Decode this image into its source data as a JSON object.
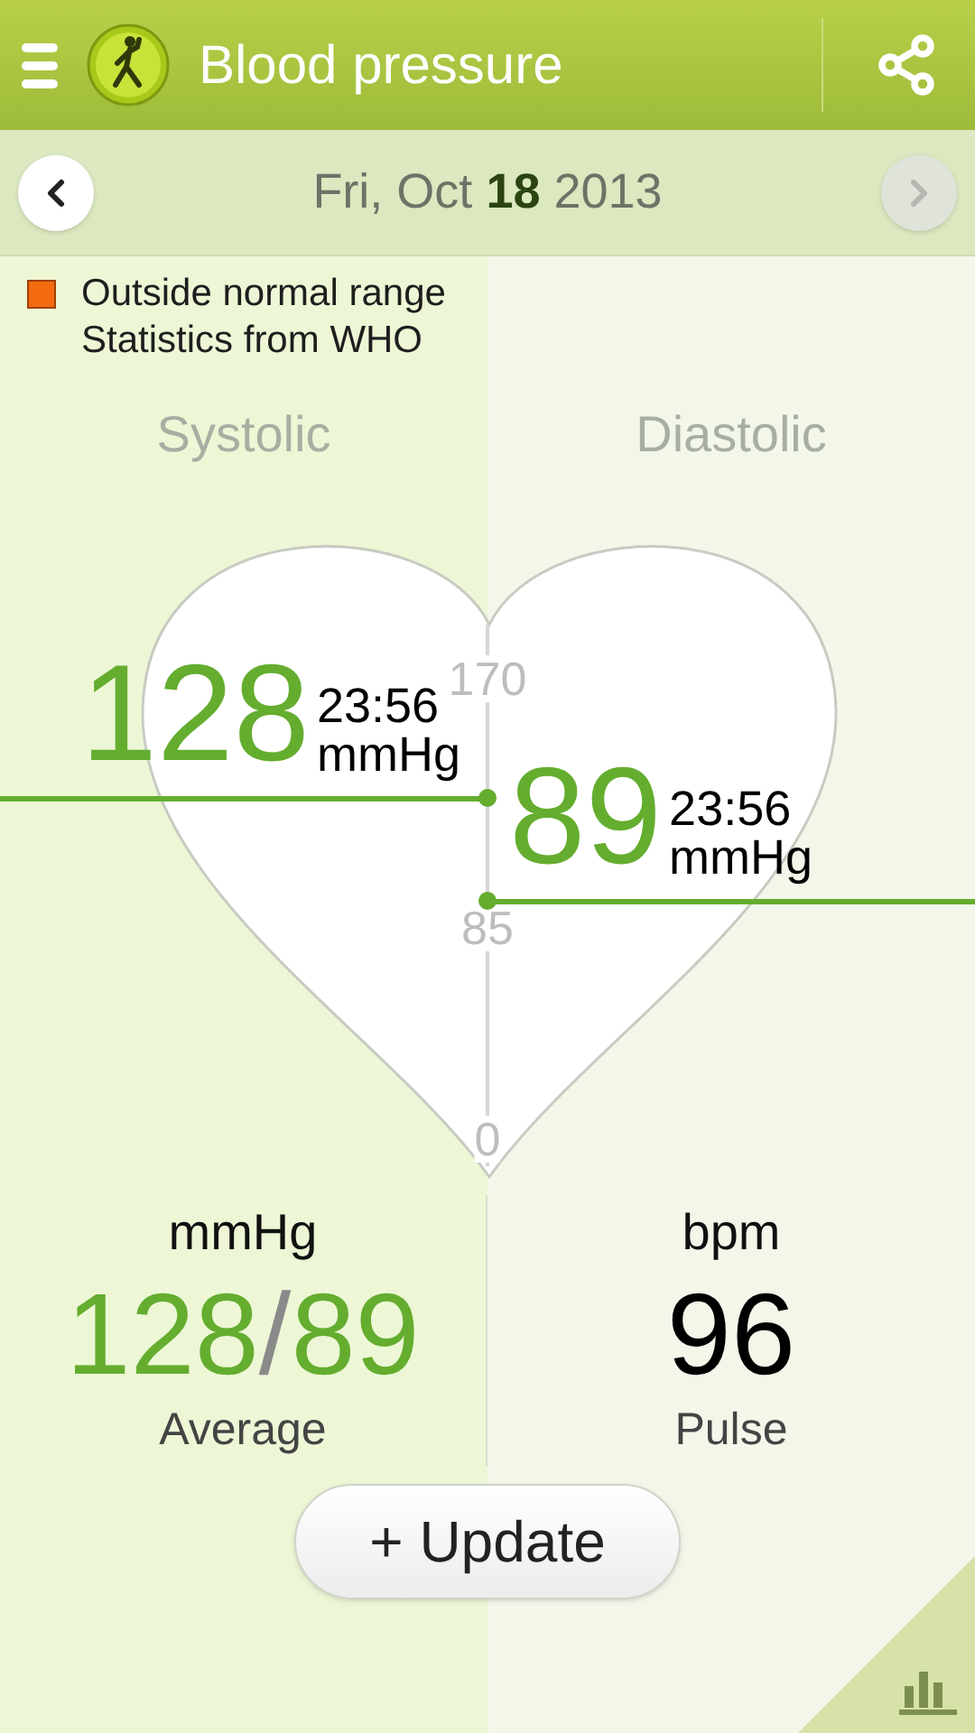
{
  "header": {
    "title": "Blood pressure"
  },
  "date_bar": {
    "date": "Fri, Oct **18** 2013",
    "prev": {
      "disabled": false
    },
    "next": {
      "disabled": true
    }
  },
  "legend": {
    "color": "#f26b10",
    "lines": [
      "Outside normal range",
      "Statistics from WHO"
    ]
  },
  "columns": [
    "Systolic",
    "Diastolic"
  ],
  "gauge": {
    "scale_labels": [
      "170",
      "85",
      "0"
    ],
    "systolic": {
      "value": "128",
      "time": "23:56",
      "unit": "mmHg"
    },
    "diastolic": {
      "value": "89",
      "time": "23:56",
      "unit": "mmHg"
    }
  },
  "summary": {
    "average": {
      "unit": "mmHg",
      "systolic": "128",
      "separator": "/",
      "diastolic": "89",
      "label": "Average"
    },
    "pulse": {
      "unit": "bpm",
      "value": "96",
      "label": "Pulse"
    }
  },
  "update_button": "+ Update"
}
